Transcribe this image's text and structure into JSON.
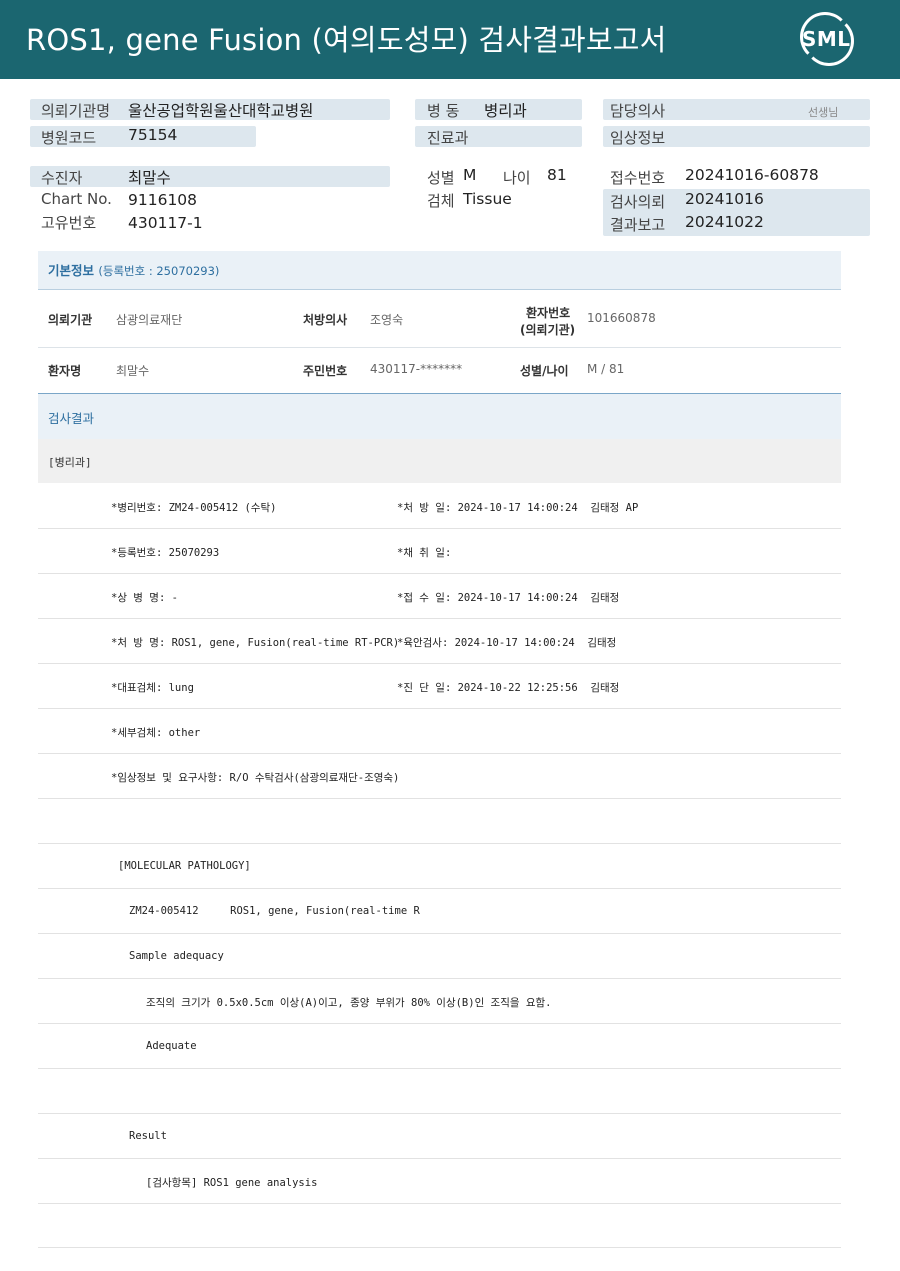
{
  "header": {
    "title": "ROS1, gene Fusion (여의도성모) 검사결과보고서",
    "logo_text": "SML"
  },
  "summary": {
    "req_inst_label": "의뢰기관명",
    "req_inst_value": "울산공업학원울산대학교병원",
    "hosp_code_label": "병원코드",
    "hosp_code_value": "75154",
    "ward_label": "병 동",
    "ward_value": "병리과",
    "dept_label": "진료과",
    "doctor_label": "담당의사",
    "doctor_suffix": "선생님",
    "clinical_label": "임상정보",
    "patient_label": "수진자",
    "patient_value": "최말수",
    "chart_label": "Chart No.",
    "chart_value": "9116108",
    "unique_label": "고유번호",
    "unique_value": "430117-1",
    "sex_label": "성별",
    "sex_value": "M",
    "age_label": "나이",
    "age_value": "81",
    "specimen_label": "검체",
    "specimen_value": "Tissue",
    "receipt_label": "접수번호",
    "receipt_value": "20241016-60878",
    "request_label": "검사의뢰",
    "request_value": "20241016",
    "report_label": "결과보고",
    "report_value": "20241022"
  },
  "basic": {
    "title": "기본정보",
    "reg": "(등록번호 : 25070293)",
    "inst_label": "의뢰기관",
    "inst_value": "삼광의료재단",
    "doc_label": "처방의사",
    "doc_value": "조영숙",
    "pno_label_1": "환자번호",
    "pno_label_2": "(의뢰기관)",
    "pno_value": "101660878",
    "name_label": "환자명",
    "name_value": "최말수",
    "rrn_label": "주민번호",
    "rrn_value": "430117-*******",
    "sexage_label": "성별/나이",
    "sexage_value": "M / 81"
  },
  "results": {
    "title": "검사결과",
    "category": "[병리과]",
    "lines": [
      {
        "left": "*병리번호: ZM24-005412 (수탁)",
        "right": "*처 방 일: 2024-10-17 14:00:24  김태정 AP"
      },
      {
        "left": "*등록번호: 25070293",
        "right": "*채 취 일:"
      },
      {
        "left": "*상 병 명: -",
        "right": "*접 수 일: 2024-10-17 14:00:24  김태정"
      },
      {
        "left": "*처 방 명: ROS1, gene, Fusion(real-time RT-PCR)",
        "right": "*육안검사: 2024-10-17 14:00:24  김태정"
      },
      {
        "left": "*대표검체: lung",
        "right": "*진 단 일: 2024-10-22 12:25:56  김태정"
      },
      {
        "left": "*세부검체: other",
        "right": ""
      },
      {
        "left": "*임상정보 및 요구사항: R/O 수탁검사(삼광의료재단-조영숙)",
        "right": ""
      }
    ],
    "mp_header": "[MOLECULAR PATHOLOGY]",
    "mp_line": "ZM24-005412     ROS1, gene, Fusion(real-time R",
    "sample_adequacy": "Sample adequacy",
    "criteria": "조직의 크기가 0.5x0.5cm 이상(A)이고, 종양 부위가 80% 이상(B)인 조직을 요함.",
    "adequate": "Adequate",
    "result_label": "Result",
    "test_item": "[검사항목] ROS1 gene analysis"
  }
}
